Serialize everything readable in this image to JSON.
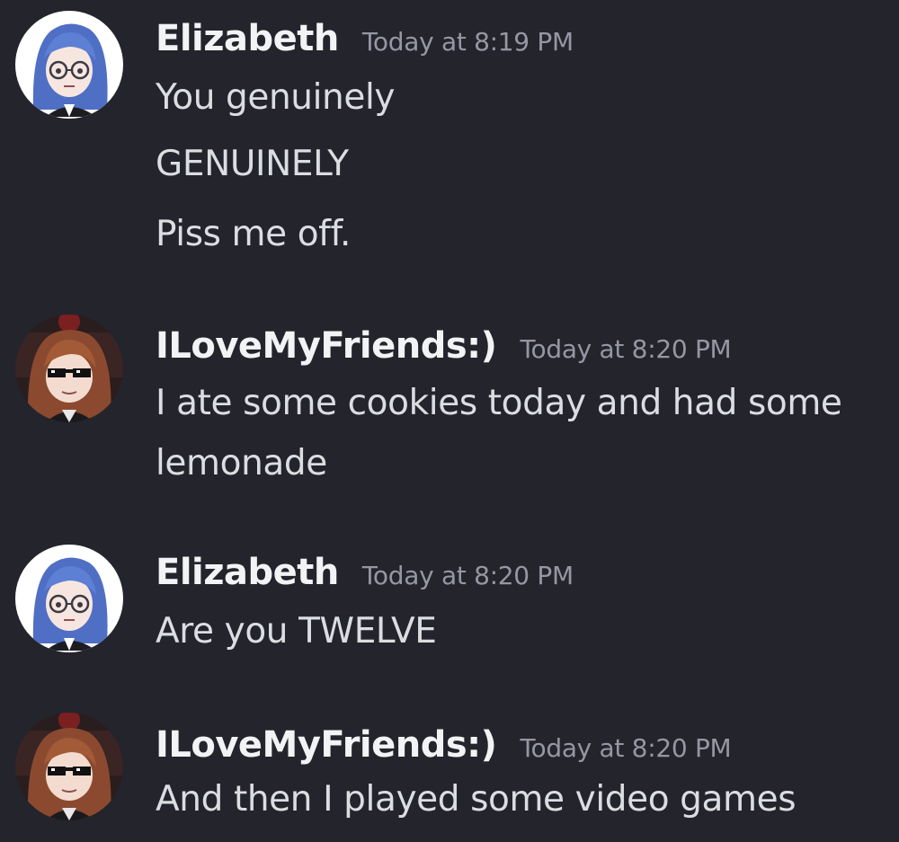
{
  "messages": [
    {
      "author": "Elizabeth",
      "timestamp": "Today at 8:19 PM",
      "avatar": "blue-haired-girl-with-glasses",
      "lines": [
        "You genuinely",
        "GENUINELY",
        "Piss me off."
      ]
    },
    {
      "author": "ILoveMyFriends:)",
      "timestamp": "Today at 8:20 PM",
      "avatar": "brown-haired-girl-with-pixel-sunglasses",
      "lines": [
        "I ate some cookies today and had some",
        "lemonade"
      ]
    },
    {
      "author": "Elizabeth",
      "timestamp": "Today at 8:20 PM",
      "avatar": "blue-haired-girl-with-glasses",
      "lines": [
        "Are you TWELVE"
      ]
    },
    {
      "author": "ILoveMyFriends:)",
      "timestamp": "Today at 8:20 PM",
      "avatar": "brown-haired-girl-with-pixel-sunglasses",
      "lines": [
        "And then I played some video games"
      ]
    }
  ],
  "colors": {
    "background": "#24242d",
    "username": "#f2f3f5",
    "timestamp": "#9597a3",
    "message_text": "#dbdee1"
  }
}
